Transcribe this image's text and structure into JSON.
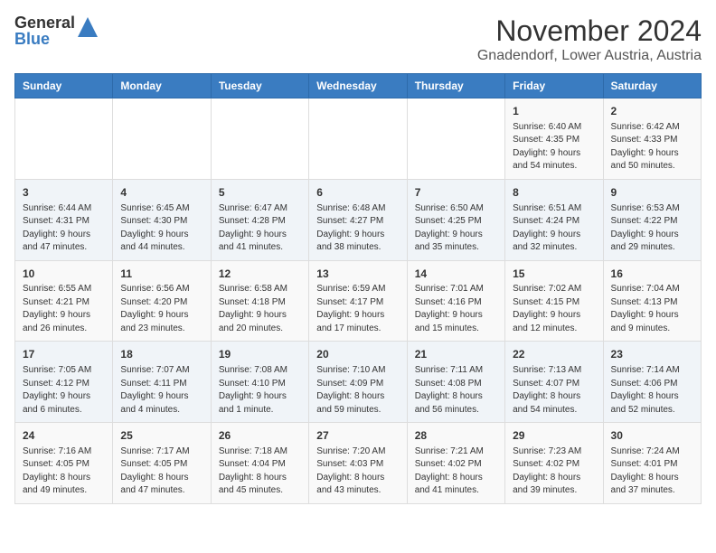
{
  "header": {
    "logo_general": "General",
    "logo_blue": "Blue",
    "month_title": "November 2024",
    "location": "Gnadendorf, Lower Austria, Austria"
  },
  "days_of_week": [
    "Sunday",
    "Monday",
    "Tuesday",
    "Wednesday",
    "Thursday",
    "Friday",
    "Saturday"
  ],
  "weeks": [
    [
      {
        "day": "",
        "info": ""
      },
      {
        "day": "",
        "info": ""
      },
      {
        "day": "",
        "info": ""
      },
      {
        "day": "",
        "info": ""
      },
      {
        "day": "",
        "info": ""
      },
      {
        "day": "1",
        "info": "Sunrise: 6:40 AM\nSunset: 4:35 PM\nDaylight: 9 hours\nand 54 minutes."
      },
      {
        "day": "2",
        "info": "Sunrise: 6:42 AM\nSunset: 4:33 PM\nDaylight: 9 hours\nand 50 minutes."
      }
    ],
    [
      {
        "day": "3",
        "info": "Sunrise: 6:44 AM\nSunset: 4:31 PM\nDaylight: 9 hours\nand 47 minutes."
      },
      {
        "day": "4",
        "info": "Sunrise: 6:45 AM\nSunset: 4:30 PM\nDaylight: 9 hours\nand 44 minutes."
      },
      {
        "day": "5",
        "info": "Sunrise: 6:47 AM\nSunset: 4:28 PM\nDaylight: 9 hours\nand 41 minutes."
      },
      {
        "day": "6",
        "info": "Sunrise: 6:48 AM\nSunset: 4:27 PM\nDaylight: 9 hours\nand 38 minutes."
      },
      {
        "day": "7",
        "info": "Sunrise: 6:50 AM\nSunset: 4:25 PM\nDaylight: 9 hours\nand 35 minutes."
      },
      {
        "day": "8",
        "info": "Sunrise: 6:51 AM\nSunset: 4:24 PM\nDaylight: 9 hours\nand 32 minutes."
      },
      {
        "day": "9",
        "info": "Sunrise: 6:53 AM\nSunset: 4:22 PM\nDaylight: 9 hours\nand 29 minutes."
      }
    ],
    [
      {
        "day": "10",
        "info": "Sunrise: 6:55 AM\nSunset: 4:21 PM\nDaylight: 9 hours\nand 26 minutes."
      },
      {
        "day": "11",
        "info": "Sunrise: 6:56 AM\nSunset: 4:20 PM\nDaylight: 9 hours\nand 23 minutes."
      },
      {
        "day": "12",
        "info": "Sunrise: 6:58 AM\nSunset: 4:18 PM\nDaylight: 9 hours\nand 20 minutes."
      },
      {
        "day": "13",
        "info": "Sunrise: 6:59 AM\nSunset: 4:17 PM\nDaylight: 9 hours\nand 17 minutes."
      },
      {
        "day": "14",
        "info": "Sunrise: 7:01 AM\nSunset: 4:16 PM\nDaylight: 9 hours\nand 15 minutes."
      },
      {
        "day": "15",
        "info": "Sunrise: 7:02 AM\nSunset: 4:15 PM\nDaylight: 9 hours\nand 12 minutes."
      },
      {
        "day": "16",
        "info": "Sunrise: 7:04 AM\nSunset: 4:13 PM\nDaylight: 9 hours\nand 9 minutes."
      }
    ],
    [
      {
        "day": "17",
        "info": "Sunrise: 7:05 AM\nSunset: 4:12 PM\nDaylight: 9 hours\nand 6 minutes."
      },
      {
        "day": "18",
        "info": "Sunrise: 7:07 AM\nSunset: 4:11 PM\nDaylight: 9 hours\nand 4 minutes."
      },
      {
        "day": "19",
        "info": "Sunrise: 7:08 AM\nSunset: 4:10 PM\nDaylight: 9 hours\nand 1 minute."
      },
      {
        "day": "20",
        "info": "Sunrise: 7:10 AM\nSunset: 4:09 PM\nDaylight: 8 hours\nand 59 minutes."
      },
      {
        "day": "21",
        "info": "Sunrise: 7:11 AM\nSunset: 4:08 PM\nDaylight: 8 hours\nand 56 minutes."
      },
      {
        "day": "22",
        "info": "Sunrise: 7:13 AM\nSunset: 4:07 PM\nDaylight: 8 hours\nand 54 minutes."
      },
      {
        "day": "23",
        "info": "Sunrise: 7:14 AM\nSunset: 4:06 PM\nDaylight: 8 hours\nand 52 minutes."
      }
    ],
    [
      {
        "day": "24",
        "info": "Sunrise: 7:16 AM\nSunset: 4:05 PM\nDaylight: 8 hours\nand 49 minutes."
      },
      {
        "day": "25",
        "info": "Sunrise: 7:17 AM\nSunset: 4:05 PM\nDaylight: 8 hours\nand 47 minutes."
      },
      {
        "day": "26",
        "info": "Sunrise: 7:18 AM\nSunset: 4:04 PM\nDaylight: 8 hours\nand 45 minutes."
      },
      {
        "day": "27",
        "info": "Sunrise: 7:20 AM\nSunset: 4:03 PM\nDaylight: 8 hours\nand 43 minutes."
      },
      {
        "day": "28",
        "info": "Sunrise: 7:21 AM\nSunset: 4:02 PM\nDaylight: 8 hours\nand 41 minutes."
      },
      {
        "day": "29",
        "info": "Sunrise: 7:23 AM\nSunset: 4:02 PM\nDaylight: 8 hours\nand 39 minutes."
      },
      {
        "day": "30",
        "info": "Sunrise: 7:24 AM\nSunset: 4:01 PM\nDaylight: 8 hours\nand 37 minutes."
      }
    ]
  ]
}
